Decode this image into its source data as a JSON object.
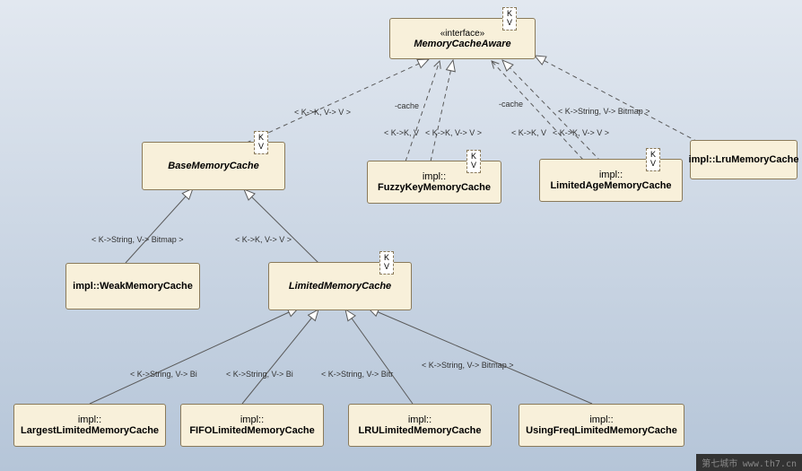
{
  "classes": {
    "interface": {
      "stereotype": "«interface»",
      "name": "MemoryCacheAware",
      "template": "K\nV"
    },
    "base": {
      "name": "BaseMemoryCache",
      "template": "K\nV"
    },
    "fuzzy": {
      "pkg": "impl::",
      "name": "FuzzyKeyMemoryCache",
      "template": "K\nV"
    },
    "limitedAge": {
      "pkg": "impl::",
      "name": "LimitedAgeMemoryCache",
      "template": "K\nV"
    },
    "lru": {
      "pkg": "impl::",
      "name": "LruMemoryCache"
    },
    "weak": {
      "pkg": "impl::",
      "name": "WeakMemoryCache"
    },
    "limited": {
      "name": "LimitedMemoryCache",
      "template": "K\nV"
    },
    "largest": {
      "pkg": "impl::",
      "name": "LargestLimitedMemoryCache"
    },
    "fifo": {
      "pkg": "impl::",
      "name": "FIFOLimitedMemoryCache"
    },
    "lruLimited": {
      "pkg": "impl::",
      "name": "LRULimitedMemoryCache"
    },
    "freq": {
      "pkg": "impl::",
      "name": "UsingFreqLimitedMemoryCache"
    }
  },
  "labels": {
    "cache1": "-cache",
    "cache2": "-cache",
    "kv1": "< K->K, V-> V >",
    "kv2": "< K->K, V",
    "kv3": "< K->K, V-> V >",
    "kv4": "< K->K, V",
    "kv5": "< K->K, V-> V >",
    "kv6": "< K->String, V-> Bitmap >",
    "kv7": "< K->String, V-> Bitmap >",
    "kv8": "< K->K, V-> V >",
    "bi1": "< K->String, V-> Bi",
    "bi2": "< K->String, V-> Bi",
    "bi3": "< K->String, V-> Bitr",
    "bi4": "< K->String, V-> Bitmap >"
  },
  "watermark": {
    "text": "第七城市",
    "url": "www.th7.cn"
  }
}
